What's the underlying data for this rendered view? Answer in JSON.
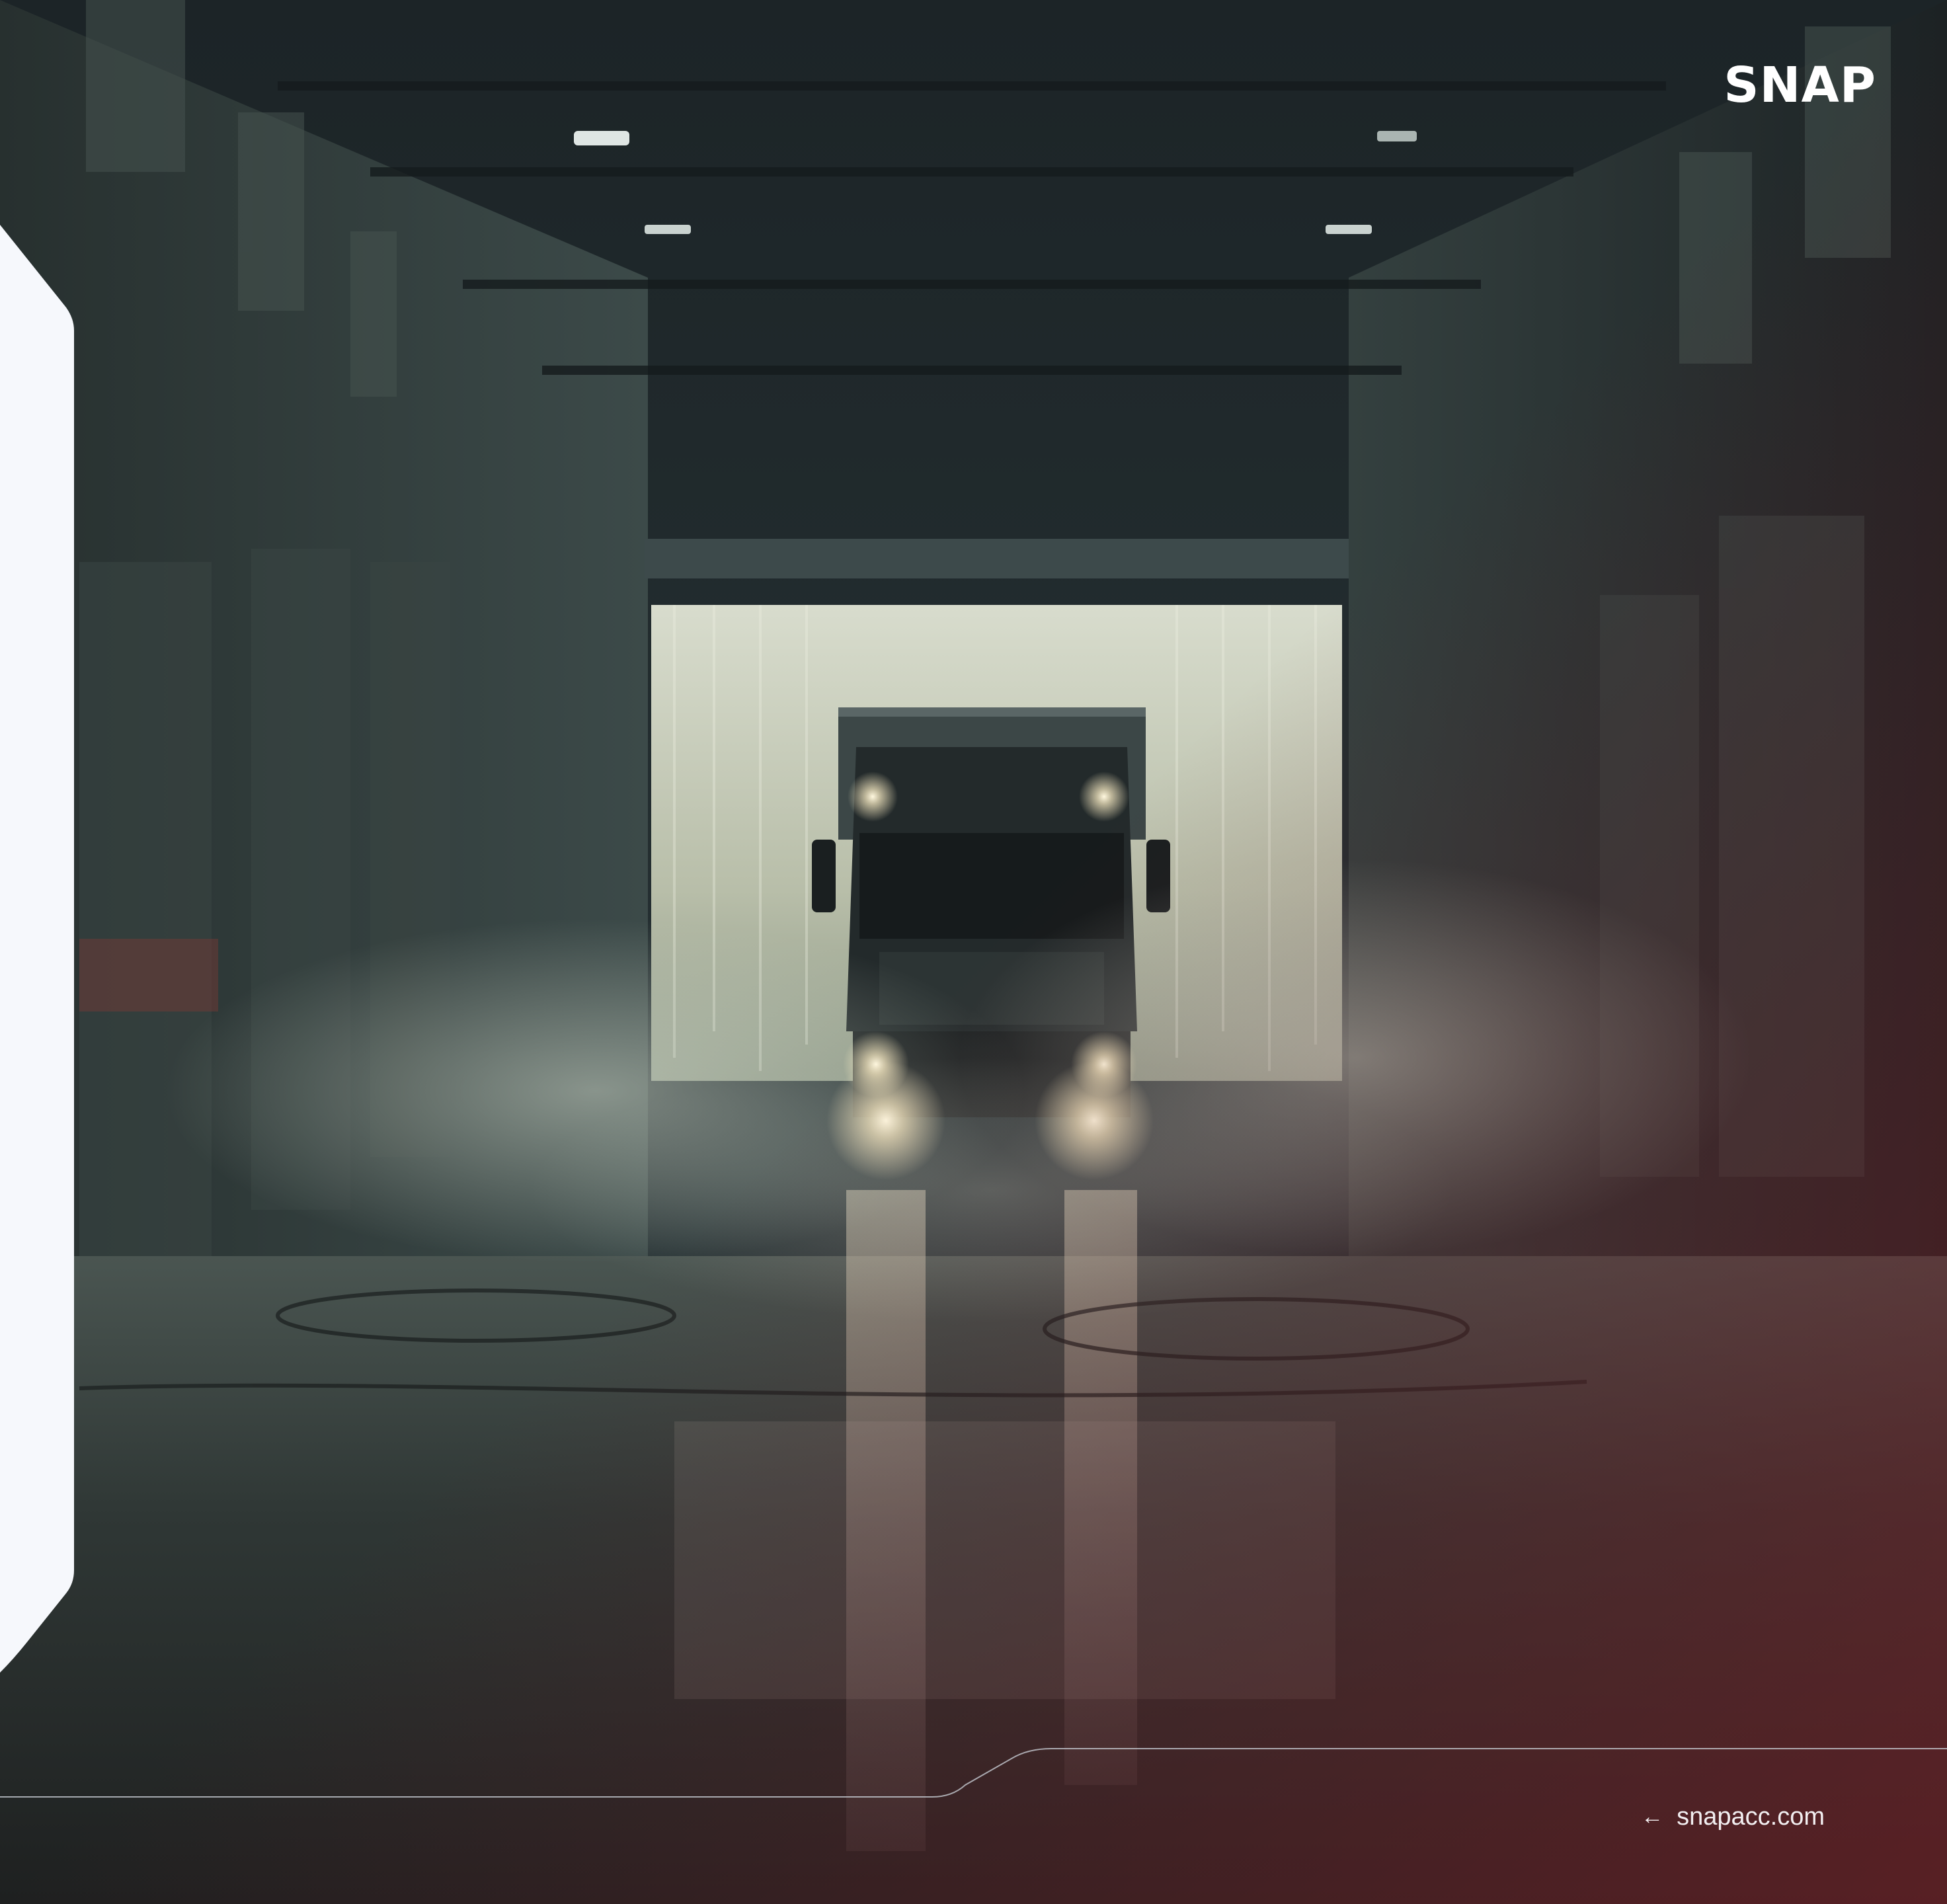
{
  "brand": {
    "logo_text": "SNAP"
  },
  "footer": {
    "link_text": "snapacc.com",
    "link_icon": "arrow-left-icon"
  },
  "palette": {
    "panel": "#f6f8fc",
    "haze": "#c9d2c4",
    "headlight": "#fff1c8",
    "floor_tint": "#6b1f25"
  }
}
